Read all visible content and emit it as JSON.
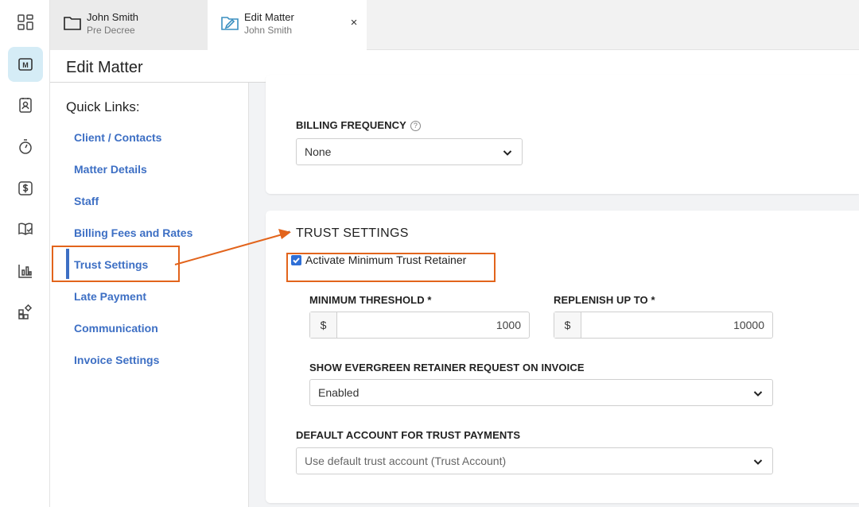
{
  "rail": {
    "icons": [
      "dashboard-icon",
      "matters-icon",
      "contacts-icon",
      "timer-icon",
      "billing-icon",
      "library-icon",
      "reports-icon",
      "apps-icon"
    ],
    "active_index": 1,
    "active_glyph": "M"
  },
  "tabs": [
    {
      "title": "John Smith",
      "subtitle": "Pre Decree",
      "icon": "folder-icon"
    },
    {
      "title": "Edit Matter",
      "subtitle": "John Smith",
      "icon": "folder-edit-icon",
      "close": "×"
    }
  ],
  "page": {
    "title": "Edit Matter"
  },
  "quick_links": {
    "title": "Quick Links:",
    "items": [
      "Client / Contacts",
      "Matter Details",
      "Staff",
      "Billing Fees and Rates",
      "Trust Settings",
      "Late Payment",
      "Communication",
      "Invoice Settings"
    ],
    "active": "Trust Settings"
  },
  "billing": {
    "frequency_label": "BILLING FREQUENCY",
    "help": "?",
    "frequency_value": "None"
  },
  "trust": {
    "section_title": "TRUST SETTINGS",
    "activate_label": "Activate Minimum Trust Retainer",
    "activate_checked": true,
    "min_threshold_label": "MINIMUM THRESHOLD *",
    "min_threshold_currency": "$",
    "min_threshold_value": "1000",
    "replenish_label": "REPLENISH UP TO *",
    "replenish_currency": "$",
    "replenish_value": "10000",
    "evergreen_label": "SHOW EVERGREEN RETAINER REQUEST ON INVOICE",
    "evergreen_value": "Enabled",
    "default_account_label": "DEFAULT ACCOUNT FOR TRUST PAYMENTS",
    "default_account_value": "Use default trust account (Trust Account)"
  },
  "colors": {
    "link": "#3d6fc4",
    "annotation": "#e2641c",
    "rail_active": "#d5ecf6",
    "checkbox": "#2f6fd6"
  }
}
